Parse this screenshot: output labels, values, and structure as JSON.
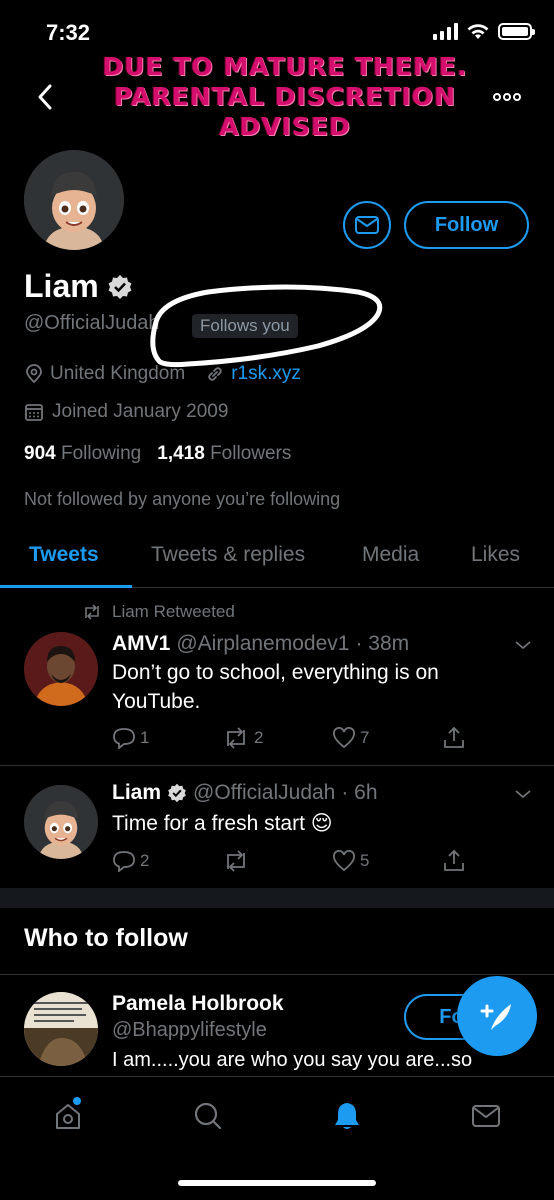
{
  "status_bar": {
    "time": "7:32"
  },
  "overlay": {
    "warning_line1": "DUE TO MATURE THEME.",
    "warning_line2": "PARENTAL DISCRETION",
    "warning_line3": "ADVISED"
  },
  "profile": {
    "name": "Liam",
    "handle": "@OfficialJudah",
    "follows_you": "Follows you",
    "follow_label": "Follow",
    "location": "United Kingdom",
    "website": "r1sk.xyz",
    "joined": "Joined January 2009",
    "following_count": "904",
    "following_label": "Following",
    "followers_count": "1,418",
    "followers_label": "Followers",
    "not_followed": "Not followed by anyone you’re following"
  },
  "tabs": [
    {
      "label": "Tweets",
      "active": true
    },
    {
      "label": "Tweets & replies",
      "active": false
    },
    {
      "label": "Media",
      "active": false
    },
    {
      "label": "Likes",
      "active": false
    }
  ],
  "tweets": [
    {
      "retweeted_by": "Liam Retweeted",
      "name": "AMV1",
      "handle": "@Airplanemodev1",
      "time": "· 38m",
      "text": "Don’t go to school, everything is on YouTube.",
      "replies": "1",
      "retweets": "2",
      "likes": "7"
    },
    {
      "name": "Liam",
      "handle": "@OfficialJudah",
      "time": "· 6h",
      "text": "Time for a fresh start 😌",
      "replies": "2",
      "retweets": "",
      "likes": "5"
    }
  ],
  "who_to_follow": {
    "title": "Who to follow",
    "name": "Pamela Holbrook",
    "handle": "@Bhappylifestyle",
    "bio": "I am.....you are who you say you are...so",
    "follow_label": "Fo"
  },
  "colors": {
    "accent": "#1d9bf0",
    "background": "#000000",
    "muted": "#71767b",
    "warning": "#d30e6c"
  },
  "nav": [
    "home-icon",
    "search-icon",
    "notifications-icon",
    "messages-icon"
  ]
}
